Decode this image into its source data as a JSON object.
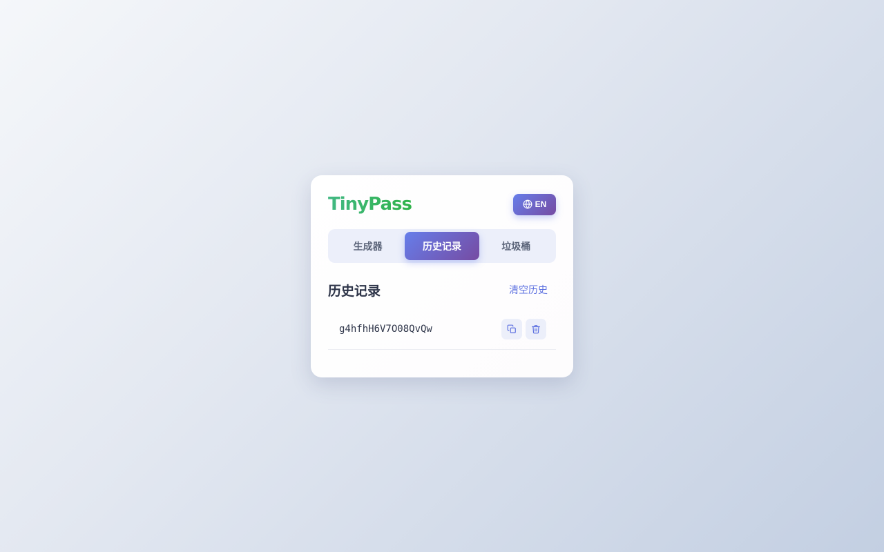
{
  "app": {
    "logo": "TinyPass",
    "language_button": "EN",
    "language_icon": "globe-icon"
  },
  "tabs": [
    {
      "label": "生成器",
      "active": false
    },
    {
      "label": "历史记录",
      "active": true
    },
    {
      "label": "垃圾桶",
      "active": false
    }
  ],
  "history": {
    "title": "历史记录",
    "clear_label": "清空历史",
    "items": [
      {
        "password": "g4hfhH6V7O08QvQw",
        "actions": [
          "copy-icon",
          "trash-icon"
        ]
      }
    ]
  },
  "colors": {
    "accent_start": "#667eea",
    "accent_end": "#764ba2",
    "logo_start": "#42b883",
    "logo_end": "#2fb34a",
    "link": "#5b6fe0"
  }
}
